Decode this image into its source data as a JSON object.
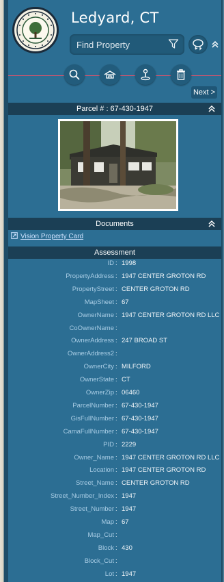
{
  "header": {
    "town_title": "Ledyard, CT",
    "search_placeholder": "Find Property"
  },
  "toolbar": {
    "tools": [
      "search-icon",
      "layers-icon",
      "pin-icon",
      "trash-icon"
    ],
    "next_label": "Next >"
  },
  "parcel": {
    "title": "Parcel # : 67-430-1947"
  },
  "documents": {
    "title": "Documents",
    "link_label": "Vision Property Card"
  },
  "assessment": {
    "title": "Assessment",
    "rows": [
      {
        "key": "ID",
        "value": "1998"
      },
      {
        "key": "PropertyAddress",
        "value": "1947 CENTER GROTON RD"
      },
      {
        "key": "PropertyStreet",
        "value": "CENTER GROTON RD"
      },
      {
        "key": "MapSheet",
        "value": "67"
      },
      {
        "key": "OwnerName",
        "value": "1947 CENTER GROTON RD LLC"
      },
      {
        "key": "CoOwnerName",
        "value": ""
      },
      {
        "key": "OwnerAddress",
        "value": "247 BROAD ST"
      },
      {
        "key": "OwnerAddress2",
        "value": ""
      },
      {
        "key": "OwnerCity",
        "value": "MILFORD"
      },
      {
        "key": "OwnerState",
        "value": "CT"
      },
      {
        "key": "OwnerZip",
        "value": "06460"
      },
      {
        "key": "ParcelNumber",
        "value": "67-430-1947"
      },
      {
        "key": "GisFullNumber",
        "value": "67-430-1947"
      },
      {
        "key": "CamaFullNumber",
        "value": "67-430-1947"
      },
      {
        "key": "PID",
        "value": "2229"
      },
      {
        "key": "Owner_Name",
        "value": "1947 CENTER GROTON RD LLC"
      },
      {
        "key": "Location",
        "value": "1947 CENTER GROTON RD"
      },
      {
        "key": "Street_Name",
        "value": "CENTER GROTON RD"
      },
      {
        "key": "Street_Number_Index",
        "value": "1947"
      },
      {
        "key": "Street_Number",
        "value": "1947"
      },
      {
        "key": "Map",
        "value": "67"
      },
      {
        "key": "Map_Cut",
        "value": ""
      },
      {
        "key": "Block",
        "value": "430"
      },
      {
        "key": "Block_Cut",
        "value": ""
      },
      {
        "key": "Lot",
        "value": "1947"
      },
      {
        "key": "Lot_Cut",
        "value": ""
      }
    ]
  },
  "colors": {
    "panel_bg": "#2c6e93",
    "section_bar": "#1b3f55",
    "key_text": "#a9cde5",
    "link": "#cfe3ff"
  }
}
